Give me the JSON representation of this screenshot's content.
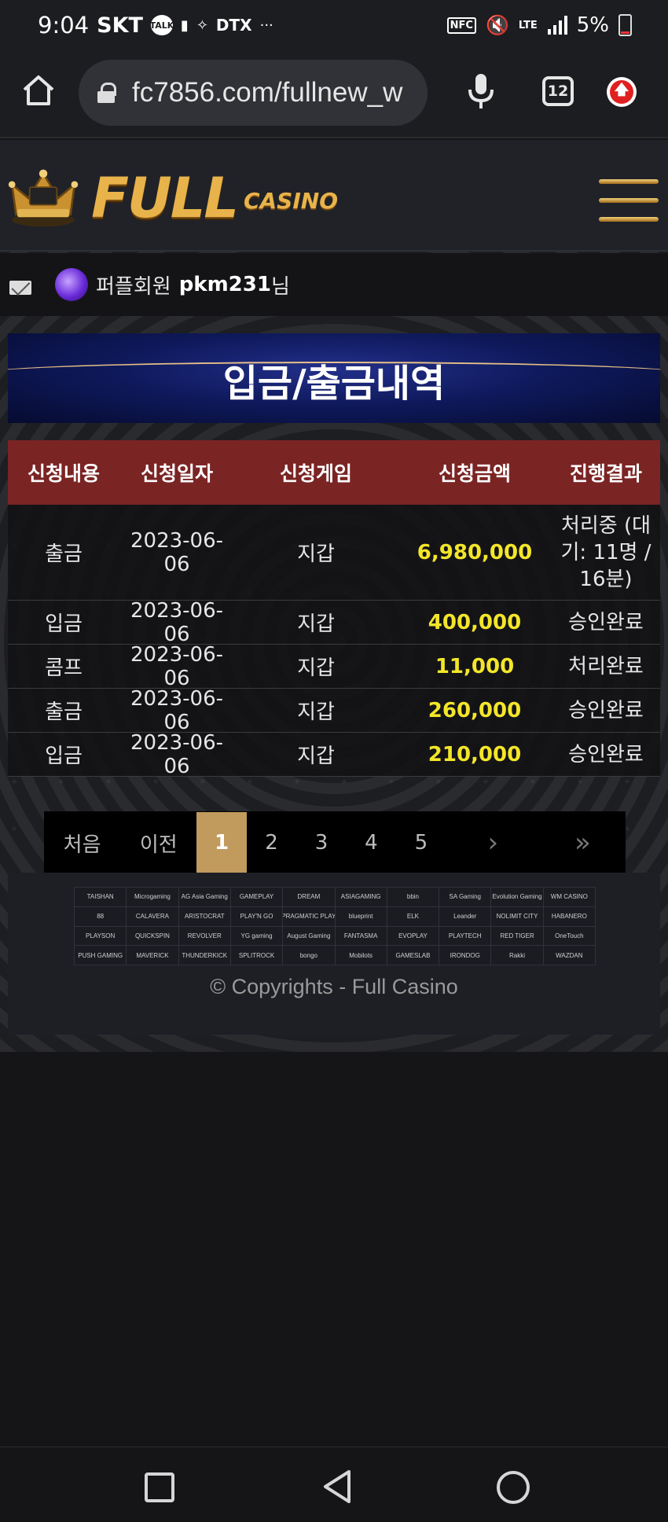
{
  "status_bar": {
    "time": "9:04",
    "carrier": "SKT",
    "talk_label": "TALK",
    "dtx_label": "DTX",
    "nfc_label": "NFC",
    "lte_label": "LTE",
    "battery": "5%",
    "more": "···"
  },
  "browser": {
    "url": "fc7856.com/fullnew_w",
    "tab_count": "12"
  },
  "site": {
    "logo_main": "FULL",
    "logo_sub": "CASINO"
  },
  "user": {
    "level": "퍼플회원",
    "name": "pkm231",
    "suffix": "님"
  },
  "page_title": "입금/출금내역",
  "table": {
    "headers": [
      "신청내용",
      "신청일자",
      "신청게임",
      "신청금액",
      "진행결과"
    ],
    "rows": [
      {
        "type": "출금",
        "date": "2023-06-06",
        "game": "지갑",
        "amount": "6,980,000",
        "result": "처리중 (대기: 11명 / 16분)"
      },
      {
        "type": "입금",
        "date": "2023-06-06",
        "game": "지갑",
        "amount": "400,000",
        "result": "승인완료"
      },
      {
        "type": "콤프",
        "date": "2023-06-06",
        "game": "지갑",
        "amount": "11,000",
        "result": "처리완료"
      },
      {
        "type": "출금",
        "date": "2023-06-06",
        "game": "지갑",
        "amount": "260,000",
        "result": "승인완료"
      },
      {
        "type": "입금",
        "date": "2023-06-06",
        "game": "지갑",
        "amount": "210,000",
        "result": "승인완료"
      }
    ]
  },
  "pagination": {
    "first": "처음",
    "prev": "이전",
    "pages": [
      "1",
      "2",
      "3",
      "4",
      "5"
    ],
    "current": "1",
    "next": "›",
    "last": "»"
  },
  "providers": [
    "TAISHAN",
    "Microgaming",
    "AG Asia Gaming",
    "GAMEPLAY",
    "DREAM",
    "ASIAGAMING",
    "bbin",
    "SA Gaming",
    "Evolution Gaming",
    "WM CASINO",
    "88",
    "CALAVERA",
    "ARISTOCRAT",
    "PLAY'N GO",
    "PRAGMATIC PLAY",
    "blueprint",
    "ELK",
    "Leander",
    "NOLIMIT CITY",
    "HABANERO",
    "PLAYSON",
    "QUICKSPIN",
    "REVOLVER",
    "YG gaming",
    "August Gaming",
    "FANTASMA",
    "EVOPLAY",
    "PLAYTECH",
    "RED TIGER",
    "OneTouch",
    "PUSH GAMING",
    "MAVERICK",
    "THUNDERKICK",
    "SPLITROCK",
    "bongo",
    "Mobilots",
    "GAMESLAB",
    "IRONDOG",
    "Rakki",
    "WAZDAN"
  ],
  "copyright": "© Copyrights - Full Casino"
}
